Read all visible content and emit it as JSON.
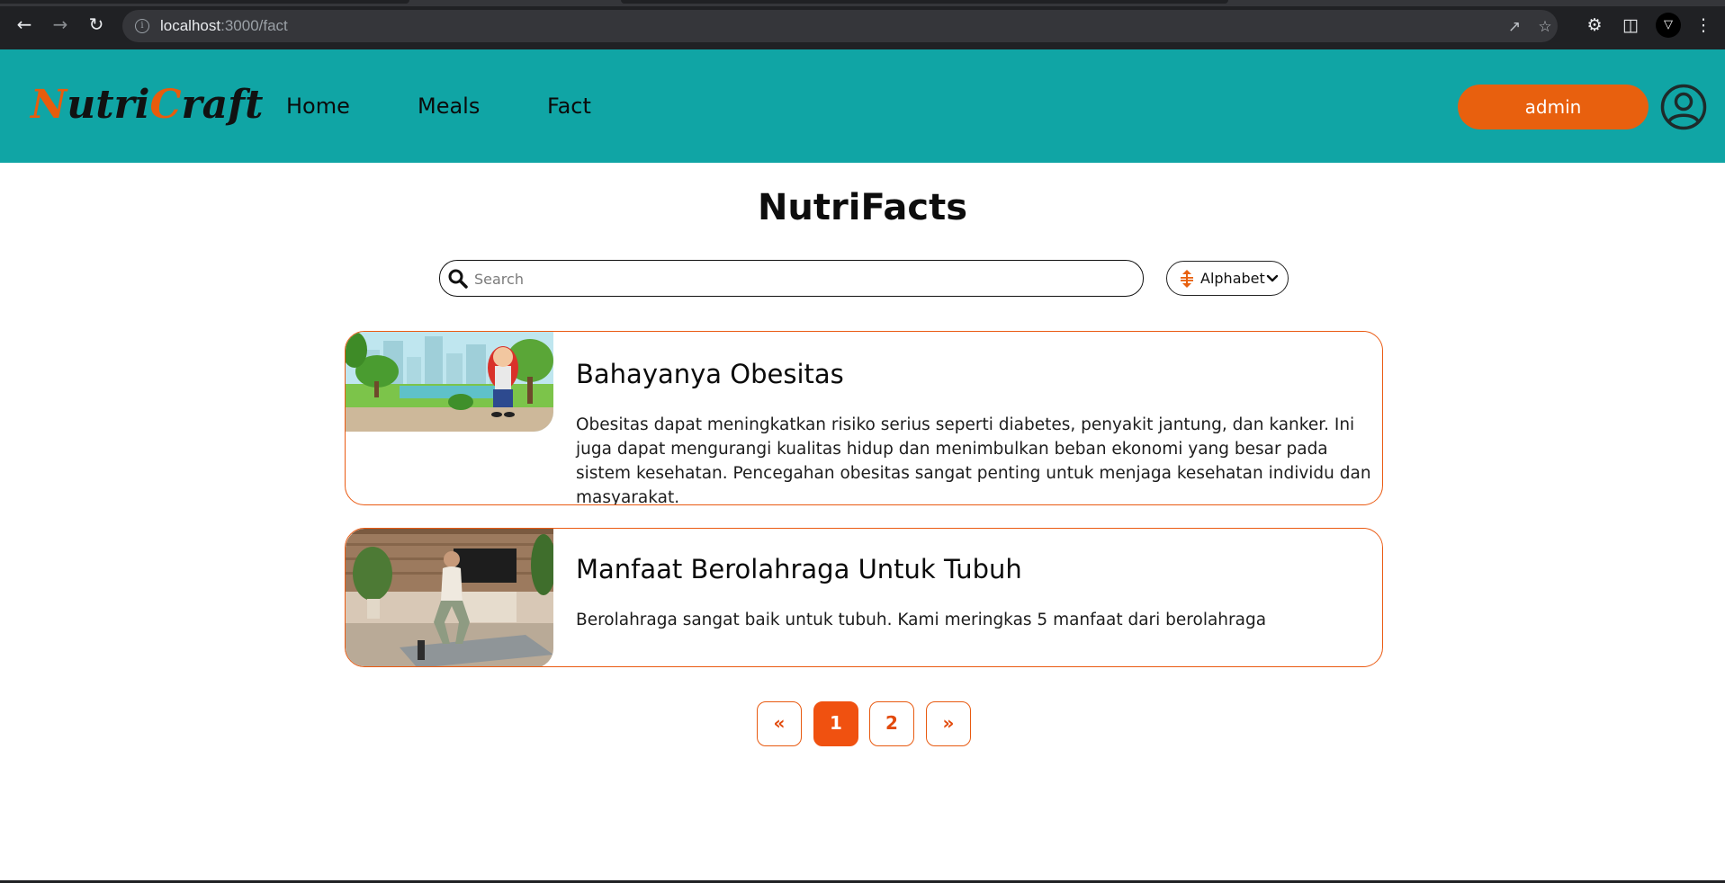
{
  "browser": {
    "url_host": "localhost",
    "url_path": ":3000/fact"
  },
  "header": {
    "logo_part1": "N",
    "logo_part2": "utri",
    "logo_part3": "C",
    "logo_part4": "raft",
    "nav": [
      {
        "label": "Home"
      },
      {
        "label": "Meals"
      },
      {
        "label": "Fact"
      }
    ],
    "user_label": "admin"
  },
  "main": {
    "title": "NutriFacts",
    "search_placeholder": "Search",
    "sort_label": "Alphabet"
  },
  "cards": [
    {
      "title": "Bahayanya Obesitas",
      "description": "Obesitas dapat meningkatkan risiko serius seperti diabetes, penyakit jantung, dan kanker. Ini juga dapat mengurangi kualitas hidup dan menimbulkan beban ekonomi yang besar pada sistem kesehatan. Pencegahan obesitas sangat penting untuk menjaga kesehatan individu dan masyarakat."
    },
    {
      "title": "Manfaat Berolahraga Untuk Tubuh",
      "description": "Berolahraga sangat baik untuk tubuh. Kami meringkas 5 manfaat dari berolahraga"
    }
  ],
  "pagination": {
    "prev": "«",
    "pages": [
      "1",
      "2"
    ],
    "next": "»",
    "current": "1"
  },
  "colors": {
    "header_bg": "#10a5a5",
    "accent_orange": "#e8600e",
    "card_border": "#ea5a12"
  }
}
